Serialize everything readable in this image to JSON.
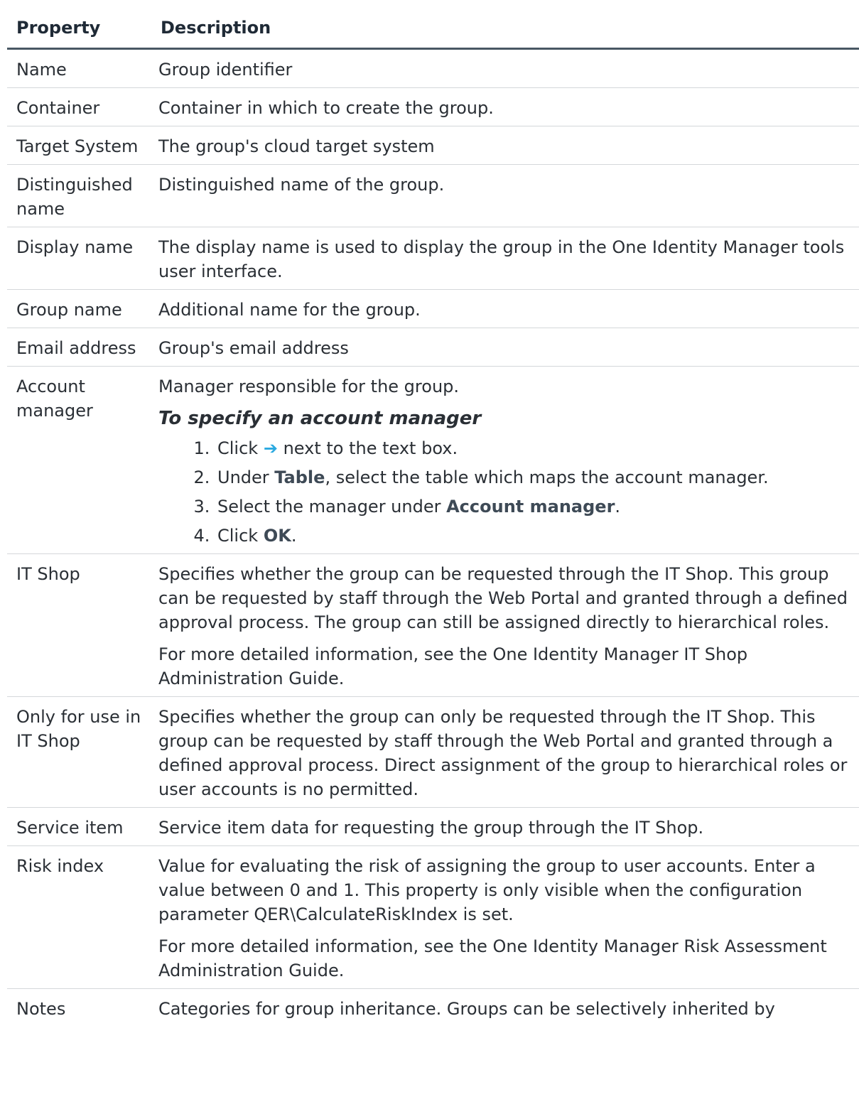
{
  "table": {
    "headers": {
      "property": "Property",
      "description": "Description"
    },
    "rows": {
      "name": {
        "property": "Name",
        "desc": "Group identifier"
      },
      "container": {
        "property": "Container",
        "desc": "Container in which to create the group."
      },
      "target_system": {
        "property": "Target System",
        "desc": "The group's cloud target system"
      },
      "distinguished_name": {
        "property": "Distinguished name",
        "desc": "Distinguished name of the group."
      },
      "display_name": {
        "property": "Display name",
        "desc": "The display name is used to display the group in the One Identity Manager tools user interface."
      },
      "group_name": {
        "property": "Group name",
        "desc": "Additional name for the group."
      },
      "email_address": {
        "property": "Email address",
        "desc": "Group's email address"
      },
      "account_manager": {
        "property": "Account manager",
        "desc": "Manager responsible for the group.",
        "procedure_title": "To specify an account manager",
        "steps": {
          "s1": {
            "before": "Click ",
            "icon": "➔",
            "after": " next to the text box."
          },
          "s2": {
            "before": "Under ",
            "bold": "Table",
            "after": ", select the table which maps the account manager."
          },
          "s3": {
            "before": "Select the manager under ",
            "bold": "Account manager",
            "after": "."
          },
          "s4": {
            "before": "Click ",
            "bold": "OK",
            "after": "."
          }
        }
      },
      "it_shop": {
        "property": "IT Shop",
        "desc": "Specifies whether the group can be requested through the IT Shop. This group can be requested by staff through the Web Portal and granted through a defined approval process. The group can still be assigned directly to hierarchical roles.",
        "more_info": "For more detailed information, see the One Identity Manager IT Shop Administration Guide."
      },
      "only_it_shop": {
        "property": "Only for use in IT Shop",
        "desc": "Specifies whether the group can only be requested through the IT Shop. This group can be requested by staff through the Web Portal and granted through a defined approval process. Direct assignment of the group to hierarchical roles or user accounts is no permitted."
      },
      "service_item": {
        "property": "Service item",
        "desc": "Service item data for requesting the group through the IT Shop."
      },
      "risk_index": {
        "property": "Risk index",
        "desc": "Value for evaluating the risk of assigning the group to user accounts. Enter a value between 0 and 1. This property is only visible when the configuration parameter QER\\CalculateRiskIndex is set.",
        "more_info": "For more detailed information, see the One Identity Manager Risk Assessment Administration Guide."
      },
      "notes": {
        "property": "Notes",
        "desc": "Categories for group inheritance. Groups can be selectively inherited by"
      }
    }
  }
}
